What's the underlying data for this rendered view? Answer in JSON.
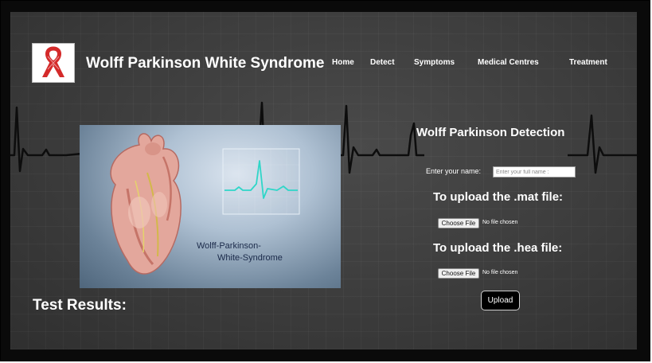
{
  "site": {
    "title": "Wolff Parkinson White Syndrome",
    "logo_icon": "awareness-ribbon-icon",
    "logo_color": "#d42a2a"
  },
  "nav": {
    "items": [
      {
        "label": "Home"
      },
      {
        "label": "Detect"
      },
      {
        "label": "Symptoms"
      },
      {
        "label": "Medical Centres"
      },
      {
        "label": "Treatment"
      }
    ]
  },
  "hero": {
    "caption_line1": "Wolff-Parkinson-",
    "caption_line2": "White-Syndrome",
    "monitor_trace_color": "#2fd6c8",
    "icon": "heart-anatomy-icon"
  },
  "detection": {
    "title": "Wolff Parkinson Detection",
    "name_label": "Enter your name:",
    "name_placeholder": "Enter your full name :",
    "name_value": "",
    "mat_heading": "To upload the .mat file:",
    "mat_button": "Choose File",
    "mat_status": "No file chosen",
    "hea_heading": "To upload the .hea file:",
    "hea_button": "Choose File",
    "hea_status": "No file chosen",
    "upload_button": "Upload"
  },
  "results": {
    "title": "Test Results:"
  },
  "colors": {
    "background": "#3c3c3c",
    "text": "#ffffff",
    "ecg_line": "#111111"
  }
}
